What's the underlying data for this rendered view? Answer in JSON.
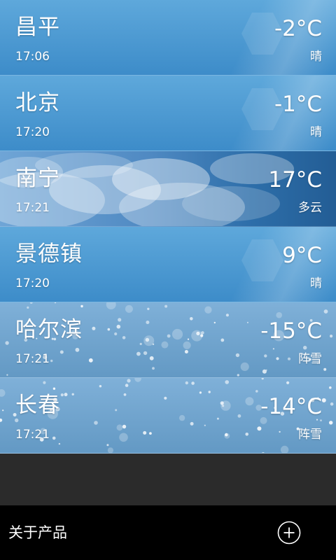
{
  "cities": [
    {
      "name": "昌平",
      "time": "17:06",
      "temp": "-2°C",
      "condition": "晴",
      "style": "sunny"
    },
    {
      "name": "北京",
      "time": "17:20",
      "temp": "-1°C",
      "condition": "晴",
      "style": "sunny"
    },
    {
      "name": "南宁",
      "time": "17:21",
      "temp": "17°C",
      "condition": "多云",
      "style": "cloudy"
    },
    {
      "name": "景德镇",
      "time": "17:20",
      "temp": "9°C",
      "condition": "晴",
      "style": "sunny"
    },
    {
      "name": "哈尔滨",
      "time": "17:21",
      "temp": "-15°C",
      "condition": "阵雪",
      "style": "snow"
    },
    {
      "name": "长春",
      "time": "17:21",
      "temp": "-14°C",
      "condition": "阵雪",
      "style": "snow"
    }
  ],
  "bottom_bar": {
    "about_label": "关于产品",
    "add_icon": "plus-circle-icon"
  },
  "colors": {
    "sunny": "#4a98d2",
    "cloudy": "#3a7cb8",
    "snow": "#6fa3cc",
    "empty_area": "#2b2b2b",
    "bottom_bar": "#000000"
  }
}
